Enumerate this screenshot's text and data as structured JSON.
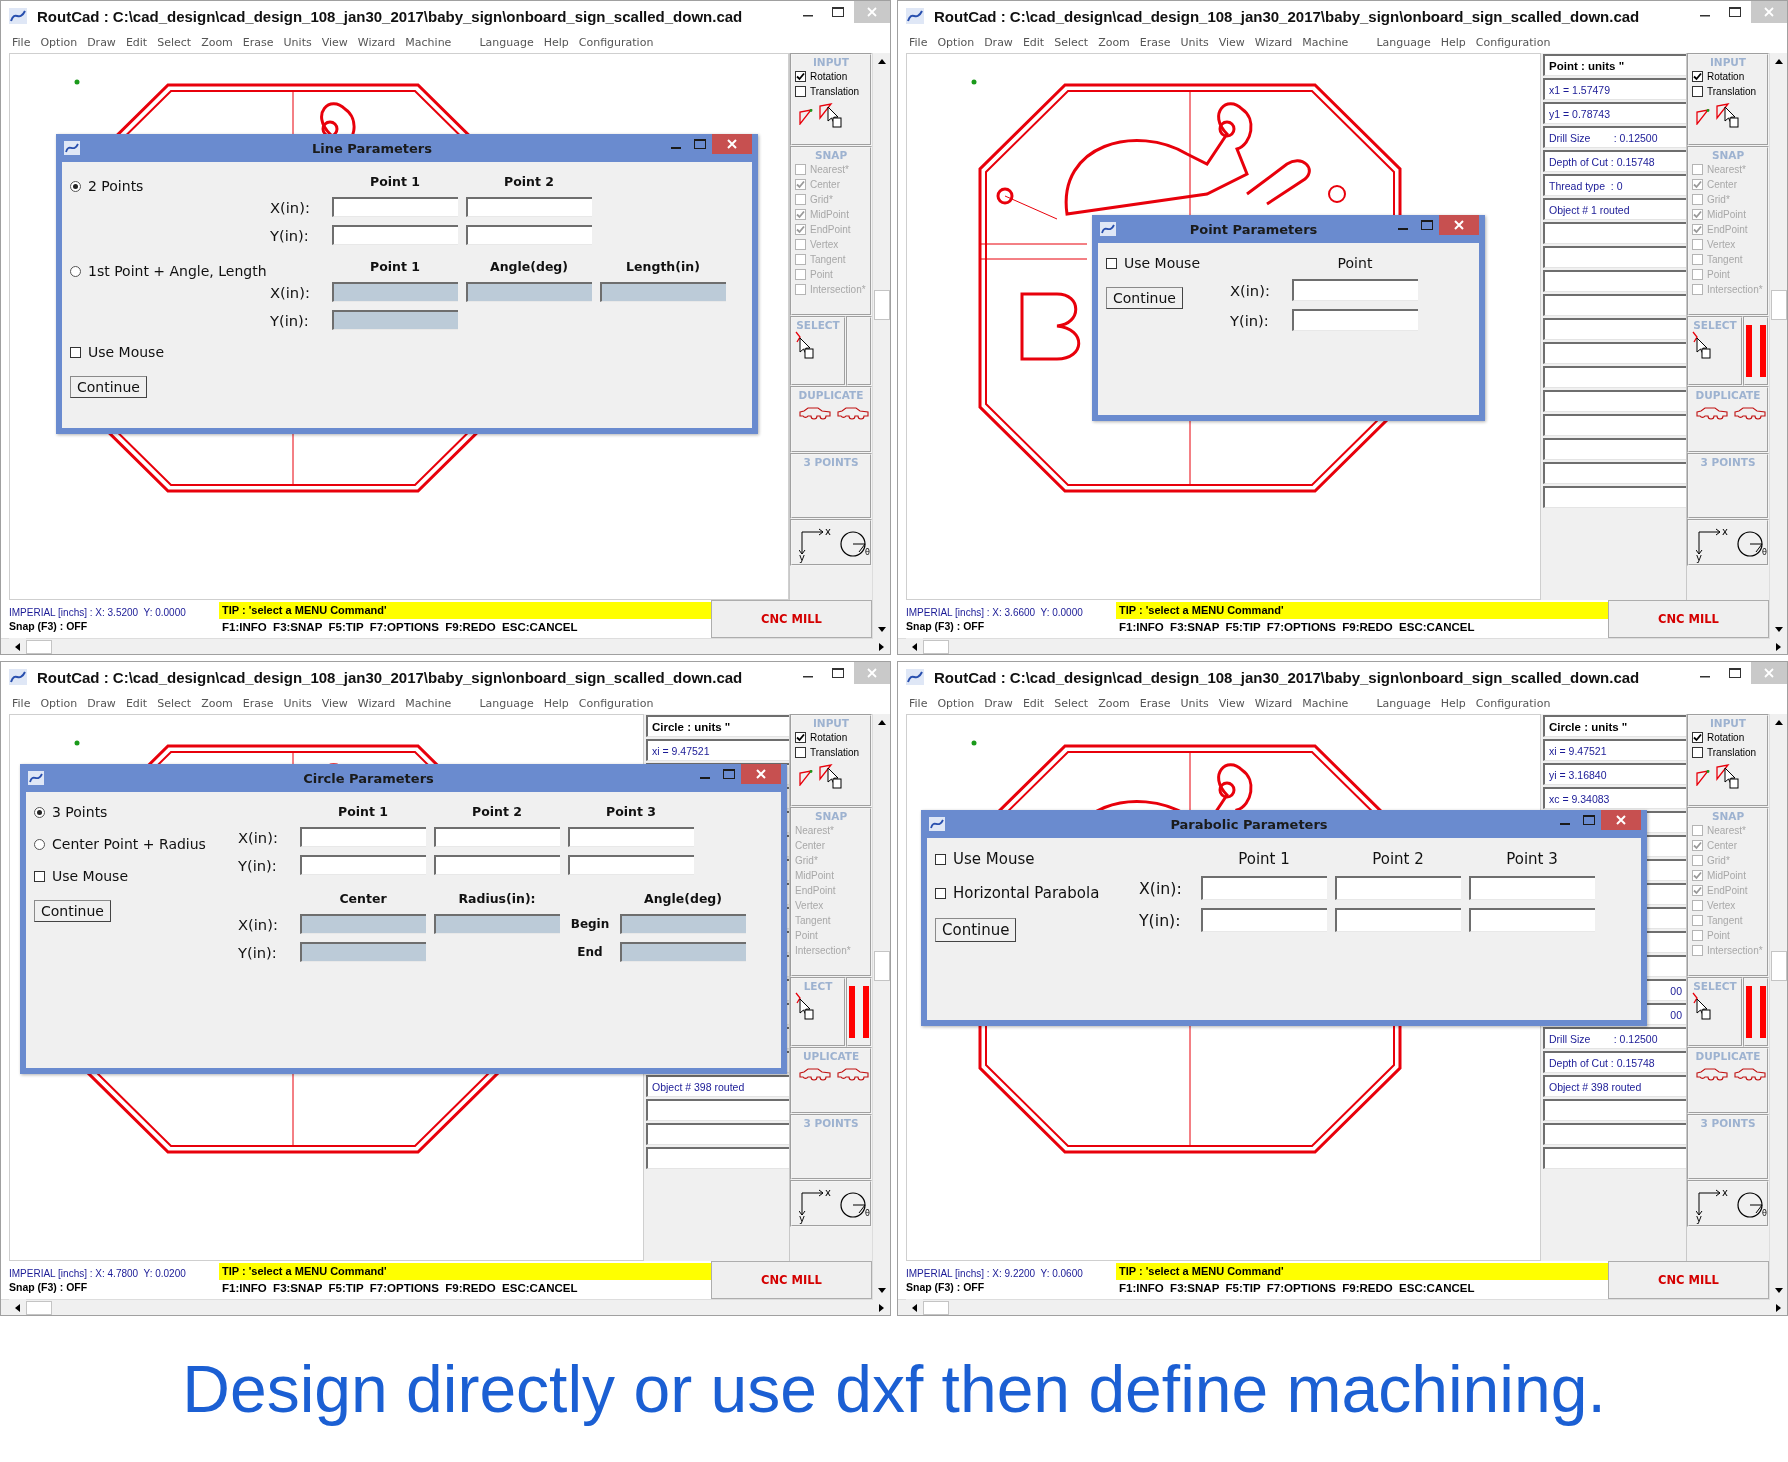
{
  "windows": [
    {
      "title": "RoutCad : C:\\cad_design\\cad_design_108_jan30_2017\\baby_sign\\onboard_sign_scalled_down.cad",
      "menu": [
        [
          "File",
          "Option",
          "Draw",
          "Edit",
          "Select",
          "Zoom",
          "Erase",
          "Units",
          "View",
          "Wizard",
          "Machine"
        ],
        [
          "Language",
          "Help",
          "Configuration"
        ]
      ],
      "tools": {
        "input": {
          "title": "INPUT",
          "options": [
            {
              "label": "Rotation",
              "checked": true
            },
            {
              "label": "Translation",
              "checked": false
            }
          ]
        },
        "snap": {
          "title": "SNAP",
          "disabled": true,
          "options": [
            {
              "label": "Nearest*",
              "checked": false
            },
            {
              "label": "Center",
              "checked": true
            },
            {
              "label": "Grid*",
              "checked": false
            },
            {
              "label": "MidPoint",
              "checked": true
            },
            {
              "label": "EndPoint",
              "checked": true
            },
            {
              "label": "Vertex",
              "checked": false
            },
            {
              "label": "Tangent",
              "checked": false
            },
            {
              "label": "Point",
              "checked": false
            },
            {
              "label": "Intersection*",
              "checked": false
            }
          ]
        },
        "select": {
          "title": "SELECT",
          "double_bar": false
        },
        "duplicate": {
          "title": "DUPLICATE"
        },
        "three_points": {
          "title": "3 POINTS"
        },
        "axis_labels": [
          "x",
          "y"
        ],
        "angle_label": "θ"
      },
      "dialog": {
        "kind": "line",
        "title": "Line Parameters",
        "button": "Continue",
        "groups": [
          {
            "option": {
              "kind": "radio",
              "label": "2 Points",
              "selected": true
            },
            "headers": [
              {
                "kind": "header",
                "text": "Point 1"
              },
              {
                "kind": "header",
                "text": "Point 2"
              }
            ],
            "rows": [
              {
                "label": "X(in):",
                "cells": [
                  {
                    "kind": "field",
                    "disabled": false
                  },
                  {
                    "kind": "field",
                    "disabled": false
                  }
                ]
              },
              {
                "label": "Y(in):",
                "cells": [
                  {
                    "kind": "field",
                    "disabled": false
                  },
                  {
                    "kind": "field",
                    "disabled": false
                  }
                ]
              }
            ]
          },
          {
            "option": {
              "kind": "radio",
              "label": "1st Point + Angle, Length",
              "selected": false
            },
            "headers": [
              {
                "kind": "header",
                "text": "Point 1"
              },
              {
                "kind": "header",
                "text": "Angle(deg)"
              },
              {
                "kind": "header",
                "text": "Length(in)"
              }
            ],
            "rows": [
              {
                "label": "X(in):",
                "cells": [
                  {
                    "kind": "field",
                    "disabled": true
                  },
                  {
                    "kind": "field",
                    "disabled": true
                  },
                  {
                    "kind": "field",
                    "disabled": true
                  }
                ]
              },
              {
                "label": "Y(in):",
                "cells": [
                  {
                    "kind": "field",
                    "disabled": true
                  }
                ]
              }
            ]
          }
        ],
        "options": [
          {
            "kind": "checkbox",
            "label": "Use Mouse",
            "checked": false
          }
        ]
      },
      "status": {
        "coords": "IMPERIAL [inchs] : X: 3.5200  Y: 0.0000",
        "snap": "Snap (F3) : OFF",
        "tip": "TIP : 'select a MENU Command'",
        "keys": "F1:INFO  F3:SNAP  F5:TIP  F7:OPTIONS  F9:REDO  ESC:CANCEL",
        "mode": "CNC MILL"
      }
    },
    {
      "title": "RoutCad : C:\\cad_design\\cad_design_108_jan30_2017\\baby_sign\\onboard_sign_scalled_down.cad",
      "menu": [
        [
          "File",
          "Option",
          "Draw",
          "Edit",
          "Select",
          "Zoom",
          "Erase",
          "Units",
          "View",
          "Wizard",
          "Machine"
        ],
        [
          "Language",
          "Help",
          "Configuration"
        ]
      ],
      "data_panel": [
        {
          "kind": "title",
          "text": "Point : units \""
        },
        {
          "kind": "value",
          "text": "x1 = 1.57479"
        },
        {
          "kind": "value",
          "text": "y1 = 0.78743"
        },
        {
          "kind": "value",
          "text": "Drill Size        : 0.12500"
        },
        {
          "kind": "value",
          "text": "Depth of Cut : 0.15748"
        },
        {
          "kind": "value",
          "text": "Thread type  : 0"
        },
        {
          "kind": "value",
          "text": "Object # 1 routed"
        },
        {
          "kind": "blank"
        },
        {
          "kind": "blank"
        },
        {
          "kind": "blank"
        },
        {
          "kind": "blank"
        },
        {
          "kind": "blank"
        },
        {
          "kind": "blank"
        },
        {
          "kind": "blank"
        },
        {
          "kind": "blank"
        },
        {
          "kind": "blank"
        },
        {
          "kind": "blank"
        },
        {
          "kind": "blank"
        },
        {
          "kind": "blank"
        }
      ],
      "tools": {
        "input": {
          "title": "INPUT",
          "options": [
            {
              "label": "Rotation",
              "checked": true
            },
            {
              "label": "Translation",
              "checked": false
            }
          ]
        },
        "snap": {
          "title": "SNAP",
          "disabled": true,
          "options": [
            {
              "label": "Nearest*",
              "checked": false
            },
            {
              "label": "Center",
              "checked": true
            },
            {
              "label": "Grid*",
              "checked": false
            },
            {
              "label": "MidPoint",
              "checked": true
            },
            {
              "label": "EndPoint",
              "checked": true
            },
            {
              "label": "Vertex",
              "checked": false
            },
            {
              "label": "Tangent",
              "checked": false
            },
            {
              "label": "Point",
              "checked": false
            },
            {
              "label": "Intersection*",
              "checked": false
            }
          ]
        },
        "select": {
          "title": "SELECT",
          "double_bar": true
        },
        "duplicate": {
          "title": "DUPLICATE"
        },
        "three_points": {
          "title": "3 POINTS"
        },
        "axis_labels": [
          "x",
          "y"
        ],
        "angle_label": "θ"
      },
      "dialog": {
        "kind": "point",
        "title": "Point Parameters",
        "button": "Continue",
        "groups": [
          {
            "headers": [
              {
                "kind": "header",
                "text": "Point"
              }
            ],
            "rows": [
              {
                "label": "X(in):",
                "cells": [
                  {
                    "kind": "field",
                    "disabled": false
                  }
                ]
              },
              {
                "label": "Y(in):",
                "cells": [
                  {
                    "kind": "field",
                    "disabled": false
                  }
                ]
              }
            ]
          }
        ],
        "options": [
          {
            "kind": "checkbox",
            "label": "Use Mouse",
            "checked": false
          }
        ]
      },
      "status": {
        "coords": "IMPERIAL [inchs] : X: 3.6600  Y: 0.0000",
        "snap": "Snap (F3) : OFF",
        "tip": "TIP : 'select a MENU Command'",
        "keys": "F1:INFO  F3:SNAP  F5:TIP  F7:OPTIONS  F9:REDO  ESC:CANCEL",
        "mode": "CNC MILL"
      }
    },
    {
      "title": "RoutCad : C:\\cad_design\\cad_design_108_jan30_2017\\baby_sign\\onboard_sign_scalled_down.cad",
      "menu": [
        [
          "File",
          "Option",
          "Draw",
          "Edit",
          "Select",
          "Zoom",
          "Erase",
          "Units",
          "View",
          "Wizard",
          "Machine"
        ],
        [
          "Language",
          "Help",
          "Configuration"
        ]
      ],
      "data_panel": [
        {
          "kind": "title",
          "text": "Circle : units \""
        },
        {
          "kind": "value",
          "text": "xi = 9.47521"
        },
        {
          "kind": "blank"
        },
        {
          "kind": "blank"
        },
        {
          "kind": "blank"
        },
        {
          "kind": "blank"
        },
        {
          "kind": "blank"
        },
        {
          "kind": "blank"
        },
        {
          "kind": "blank"
        },
        {
          "kind": "blank"
        },
        {
          "kind": "blank"
        },
        {
          "kind": "blank"
        },
        {
          "kind": "blank"
        },
        {
          "kind": "blank"
        },
        {
          "kind": "blank"
        },
        {
          "kind": "value",
          "text": "Object # 398 routed"
        },
        {
          "kind": "blank"
        },
        {
          "kind": "blank"
        },
        {
          "kind": "blank"
        }
      ],
      "tools": {
        "input": {
          "title": "INPUT",
          "options": [
            {
              "label": "Rotation",
              "checked": true
            },
            {
              "label": "Translation",
              "checked": false
            }
          ]
        },
        "snap": {
          "title": "SNAP",
          "disabled": true,
          "options": [
            {
              "label": "Nearest*"
            },
            {
              "label": "Center"
            },
            {
              "label": "Grid*"
            },
            {
              "label": "MidPoint"
            },
            {
              "label": "EndPoint"
            },
            {
              "label": "Vertex"
            },
            {
              "label": "Tangent"
            },
            {
              "label": "Point"
            },
            {
              "label": "Intersection*"
            }
          ]
        },
        "select": {
          "title": "LECT",
          "double_bar": true
        },
        "duplicate": {
          "title": "UPLICATE"
        },
        "three_points": {
          "title": "3 POINTS"
        },
        "axis_labels": [
          "x",
          "y"
        ],
        "angle_label": "θ"
      },
      "dialog": {
        "kind": "circle",
        "title": "Circle Parameters",
        "button": "Continue",
        "groups": [
          {
            "headers": [
              {
                "kind": "header",
                "text": "Point 1"
              },
              {
                "kind": "header",
                "text": "Point 2"
              },
              {
                "kind": "header",
                "text": "Point 3"
              }
            ],
            "rows": [
              {
                "label": "X(in):",
                "cells": [
                  {
                    "kind": "field",
                    "disabled": false
                  },
                  {
                    "kind": "field",
                    "disabled": false
                  },
                  {
                    "kind": "field",
                    "disabled": false
                  }
                ]
              },
              {
                "label": "Y(in):",
                "cells": [
                  {
                    "kind": "field",
                    "disabled": false
                  },
                  {
                    "kind": "field",
                    "disabled": false
                  },
                  {
                    "kind": "field",
                    "disabled": false
                  }
                ]
              }
            ]
          },
          {
            "headers": [
              {
                "kind": "header",
                "text": "Center"
              },
              {
                "kind": "header",
                "text": "Radius(in):"
              },
              {
                "kind": "gap"
              },
              {
                "kind": "header",
                "text": "Angle(deg)"
              }
            ],
            "rows": [
              {
                "label": "X(in):",
                "cells": [
                  {
                    "kind": "field",
                    "disabled": true
                  },
                  {
                    "kind": "field",
                    "disabled": true
                  },
                  {
                    "kind": "text",
                    "text": "Begin"
                  },
                  {
                    "kind": "field",
                    "disabled": true
                  }
                ]
              },
              {
                "label": "Y(in):",
                "cells": [
                  {
                    "kind": "field",
                    "disabled": true
                  },
                  {
                    "kind": "gap"
                  },
                  {
                    "kind": "text",
                    "text": "End"
                  },
                  {
                    "kind": "field",
                    "disabled": true
                  }
                ]
              }
            ]
          }
        ],
        "options": [
          {
            "kind": "radio",
            "label": "3 Points",
            "selected": true
          },
          {
            "kind": "radio",
            "label": "Center Point + Radius",
            "selected": false
          },
          {
            "kind": "checkbox",
            "label": "Use Mouse",
            "checked": false
          }
        ]
      },
      "status": {
        "coords": "IMPERIAL [inchs] : X: 4.7800  Y: 0.0200",
        "snap": "Snap (F3) : OFF",
        "tip": "TIP : 'select a MENU Command'",
        "keys": "F1:INFO  F3:SNAP  F5:TIP  F7:OPTIONS  F9:REDO  ESC:CANCEL",
        "mode": "CNC MILL"
      }
    },
    {
      "title": "RoutCad : C:\\cad_design\\cad_design_108_jan30_2017\\baby_sign\\onboard_sign_scalled_down.cad",
      "menu": [
        [
          "File",
          "Option",
          "Draw",
          "Edit",
          "Select",
          "Zoom",
          "Erase",
          "Units",
          "View",
          "Wizard",
          "Machine"
        ],
        [
          "Language",
          "Help",
          "Configuration"
        ]
      ],
      "data_panel": [
        {
          "kind": "title",
          "text": "Circle : units \""
        },
        {
          "kind": "value",
          "text": "xi = 9.47521"
        },
        {
          "kind": "value",
          "text": "yi = 3.16840"
        },
        {
          "kind": "value",
          "text": "xc = 9.34083"
        },
        {
          "kind": "blank"
        },
        {
          "kind": "blank"
        },
        {
          "kind": "blank"
        },
        {
          "kind": "blank"
        },
        {
          "kind": "blank"
        },
        {
          "kind": "blank"
        },
        {
          "kind": "blank"
        },
        {
          "kind": "tail",
          "text": "00"
        },
        {
          "kind": "tail",
          "text": "00"
        },
        {
          "kind": "value",
          "text": "Drill Size        : 0.12500"
        },
        {
          "kind": "value",
          "text": "Depth of Cut : 0.15748"
        },
        {
          "kind": "value",
          "text": "Object # 398 routed"
        },
        {
          "kind": "blank"
        },
        {
          "kind": "blank"
        },
        {
          "kind": "blank"
        }
      ],
      "tools": {
        "input": {
          "title": "INPUT",
          "options": [
            {
              "label": "Rotation",
              "checked": true
            },
            {
              "label": "Translation",
              "checked": false
            }
          ]
        },
        "snap": {
          "title": "SNAP",
          "disabled": true,
          "options": [
            {
              "label": "Nearest*",
              "checked": false
            },
            {
              "label": "Center",
              "checked": true
            },
            {
              "label": "Grid*",
              "checked": false
            },
            {
              "label": "MidPoint",
              "checked": true
            },
            {
              "label": "EndPoint",
              "checked": true
            },
            {
              "label": "Vertex",
              "checked": false
            },
            {
              "label": "Tangent",
              "checked": false
            },
            {
              "label": "Point",
              "checked": false
            },
            {
              "label": "Intersection*",
              "checked": false
            }
          ]
        },
        "select": {
          "title": "SELECT",
          "double_bar": true
        },
        "duplicate": {
          "title": "DUPLICATE"
        },
        "three_points": {
          "title": "3 POINTS"
        },
        "axis_labels": [
          "x",
          "y"
        ],
        "angle_label": "θ"
      },
      "dialog": {
        "kind": "parabola",
        "title": "Parabolic Parameters",
        "button": "Continue",
        "groups": [
          {
            "headers": [
              {
                "kind": "header",
                "text": "Point 1"
              },
              {
                "kind": "header",
                "text": "Point 2"
              },
              {
                "kind": "header",
                "text": "Point 3"
              }
            ],
            "rows": [
              {
                "label": "X(in):",
                "cells": [
                  {
                    "kind": "field",
                    "disabled": false
                  },
                  {
                    "kind": "field",
                    "disabled": false
                  },
                  {
                    "kind": "field",
                    "disabled": false
                  }
                ]
              },
              {
                "label": "Y(in):",
                "cells": [
                  {
                    "kind": "field",
                    "disabled": false
                  },
                  {
                    "kind": "field",
                    "disabled": false
                  },
                  {
                    "kind": "field",
                    "disabled": false
                  }
                ]
              }
            ]
          }
        ],
        "options": [
          {
            "kind": "checkbox",
            "label": "Use Mouse",
            "checked": false
          },
          {
            "kind": "checkbox",
            "label": "Horizontal Parabola",
            "checked": false
          }
        ]
      },
      "status": {
        "coords": "IMPERIAL [inchs] : X: 9.2200  Y: 0.0600",
        "snap": "Snap (F3) : OFF",
        "tip": "TIP : 'select a MENU Command'",
        "keys": "F1:INFO  F3:SNAP  F5:TIP  F7:OPTIONS  F9:REDO  ESC:CANCEL",
        "mode": "CNC MILL"
      }
    }
  ],
  "caption": "Design directly or use dxf then define machining."
}
